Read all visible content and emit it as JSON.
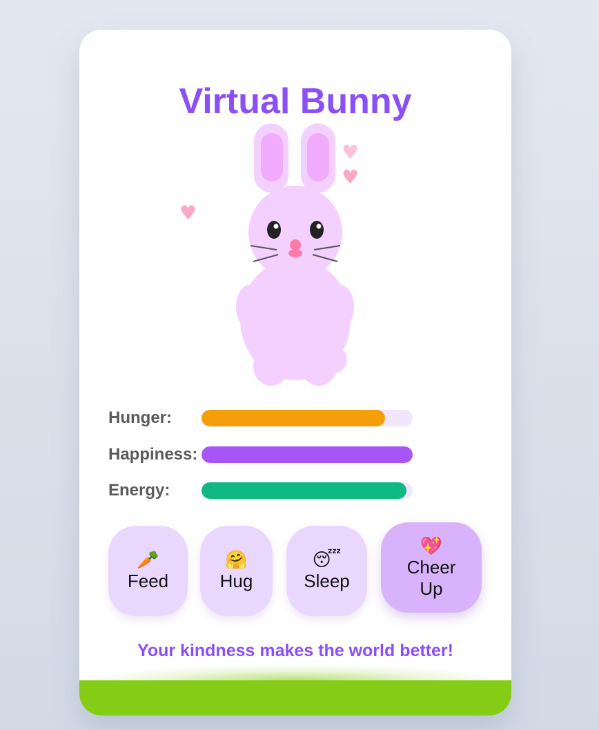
{
  "game": {
    "title": "Virtual Bunny",
    "message": "Your kindness makes the world better!"
  },
  "stats": [
    {
      "label": "Hunger:",
      "value": 0.87,
      "color": "#f59e0b"
    },
    {
      "label": "Happiness:",
      "value": 1.0,
      "color": "#a855f7"
    },
    {
      "label": "Energy:",
      "value": 0.97,
      "color": "#10b981"
    }
  ],
  "actions": {
    "feed": {
      "icon": "🥕",
      "label": "Feed"
    },
    "hug": {
      "icon": "🤗",
      "label": "Hug"
    },
    "sleep": {
      "icon": "😴",
      "label": "Sleep"
    },
    "cheer": {
      "icon": "💖",
      "label": "Cheer Up"
    }
  },
  "hearts": {
    "glyph": "♥"
  },
  "colors": {
    "accent": "#8b4ff5",
    "bunny": "#f3d0fe",
    "bunny_ear_inner": "#f0abfc",
    "grass": "#84cc16",
    "heart": "#f9a8c6"
  }
}
